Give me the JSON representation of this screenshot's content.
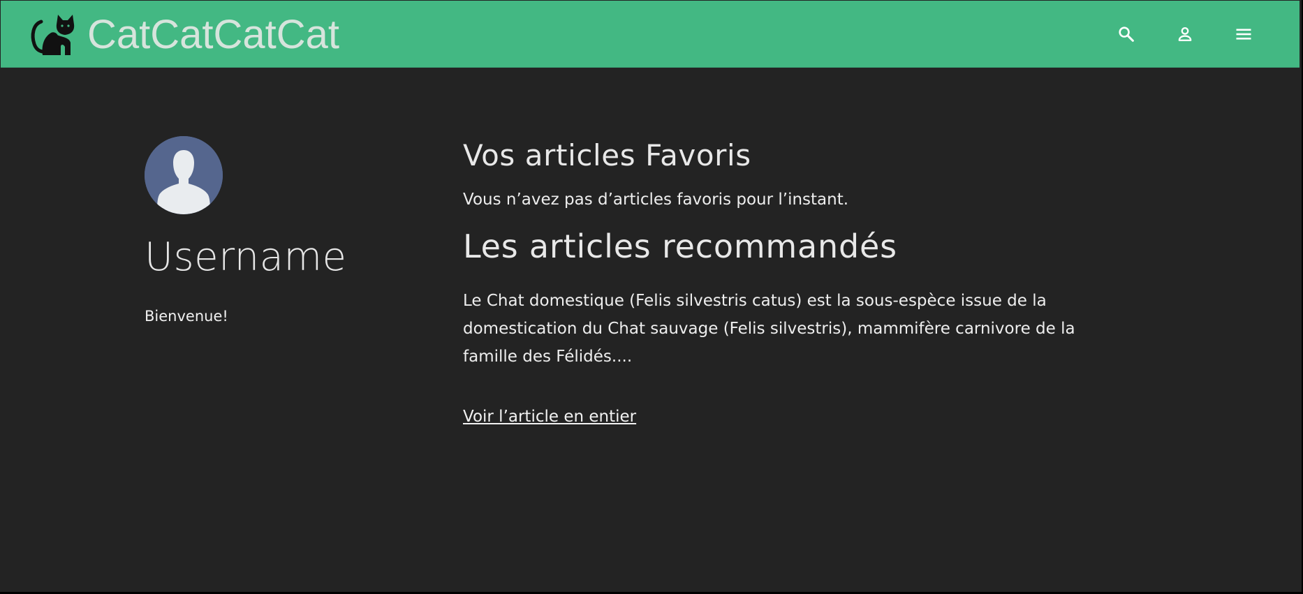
{
  "header": {
    "brand_name": "CatCatCatCat",
    "logo_icon": "cat-silhouette-icon",
    "icons": [
      "search-icon",
      "user-icon",
      "menu-icon"
    ],
    "background_color": "#43b883"
  },
  "profile": {
    "avatar_icon": "default-user-avatar-icon",
    "username": "Username",
    "welcome": "Bienvenue!"
  },
  "favorites": {
    "heading": "Vos articles Favoris",
    "empty_message": "Vous n’avez pas d’articles favoris pour l’instant."
  },
  "recommended": {
    "heading": "Les articles recommandés",
    "excerpt": "Le Chat domestique (Felis silvestris catus) est la sous-espèce issue de la domestication du Chat sauvage (Felis silvestris), mammifère carnivore de la famille des Félidés....",
    "link_label": "Voir l’article en entier"
  },
  "colors": {
    "page_background": "#232323",
    "text": "#eeeeee",
    "avatar_background": "#55668e"
  }
}
